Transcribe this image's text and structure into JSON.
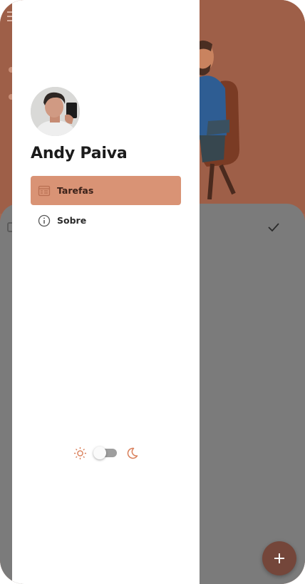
{
  "user": {
    "name": "Andy Paiva"
  },
  "nav": {
    "items": [
      {
        "label": "Tarefas",
        "icon": "task-list-icon",
        "active": true
      },
      {
        "label": "Sobre",
        "icon": "info-icon",
        "active": false
      }
    ]
  },
  "theme": {
    "light_icon": "sun-icon",
    "dark_icon": "moon-icon",
    "dark_mode": false
  },
  "fab": {
    "icon": "plus-icon"
  },
  "colors": {
    "accent": "#d99375",
    "icon_accent": "#d97f5a",
    "scrim_sheet": "#7b7b7b",
    "header_bg": "#9e5f48"
  }
}
